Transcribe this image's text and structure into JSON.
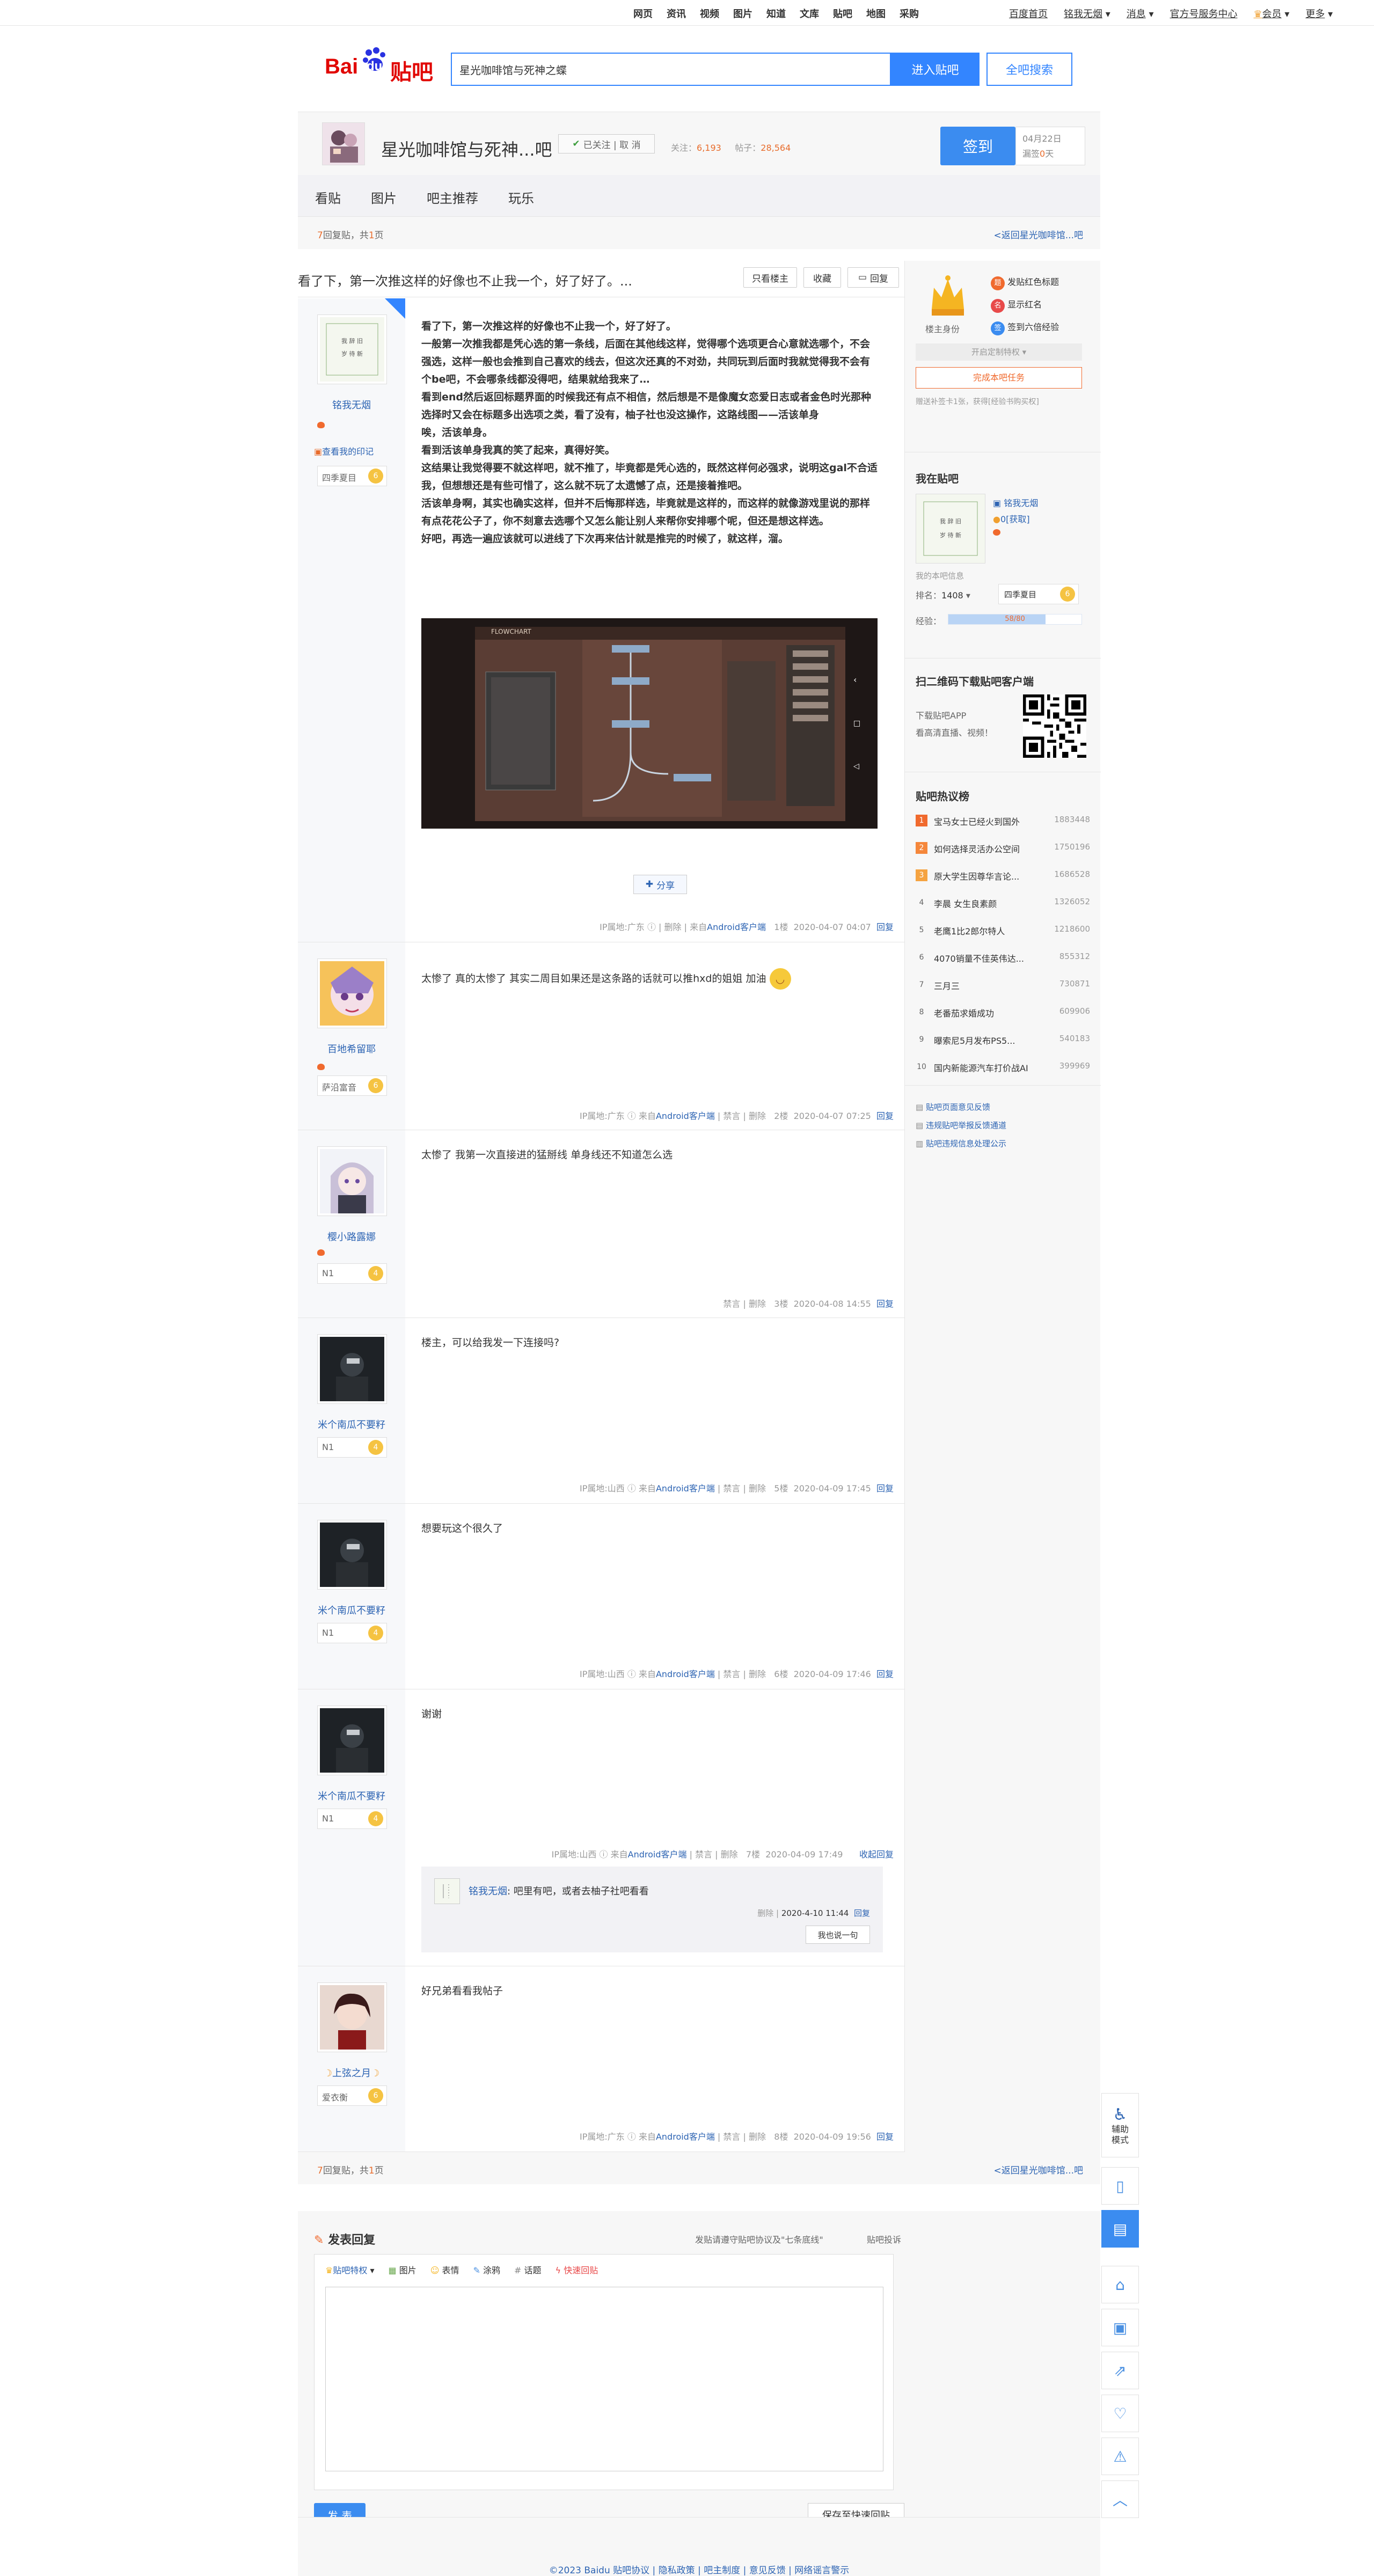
{
  "topnav": {
    "links": [
      "网页",
      "资讯",
      "视频",
      "图片",
      "知道",
      "文库",
      "贴吧",
      "地图",
      "采购"
    ],
    "right": [
      "百度首页",
      "铭我无烟",
      "消息",
      "官方号服务中心",
      "会员",
      "更多"
    ]
  },
  "header": {
    "logo_bai": "Bai",
    "logo_du": "du",
    "logo_tieba": "贴吧",
    "search_value": "星光咖啡馆与死神之蝶",
    "enter_label": "进入贴吧",
    "all_label": "全吧搜索"
  },
  "forum": {
    "name": "星光咖啡馆与死神...吧",
    "follow": "已关注 | 取 消",
    "follow_label": "关注：",
    "follow_count": "6,193",
    "posts_label": "帖子：",
    "posts_count": "28,564",
    "sign": "签到",
    "sign_date": "04月22日",
    "sign_days_label": "漏签",
    "sign_days": "0",
    "sign_days_unit": "天"
  },
  "tabs": [
    "看贴",
    "图片",
    "吧主推荐",
    "玩乐"
  ],
  "pager": {
    "replies": "7",
    "text": "回复贴，共",
    "pages": "1",
    "unit": "页",
    "back": "<返回星光咖啡馆...吧"
  },
  "thread": {
    "title": "看了下，第一次推这样的好像也不止我一个，好了好了。...",
    "only_op": "只看楼主",
    "collect": "收藏",
    "reply": "回复"
  },
  "posts": [
    {
      "author": "铭我无烟",
      "badge": "查看我的印记",
      "level_name": "四季夏目",
      "level": "6",
      "paragraphs": [
        "看了下，第一次推这样的好像也不止我一个，好了好了。",
        "一般第一次推我都是凭心选的第一条线，后面在其他线这样，觉得哪个选项更合心意就选哪个，不会强选，这样一般也会推到自己喜欢的线去，但这次还真的不对劲，共同玩到后面时我就觉得我不会有个be吧，不会哪条线都没得吧，结果就给我来了…",
        "看到end然后返回标题界面的时候我还有点不相信，然后想是不是像魔女恋爱日志或者金色时光那种选择时又会在标题多出选项之类，看了没有，柚子社也没这操作，这路线图——活该单身",
        "唉，活该单身。",
        "看到活该单身我真的笑了起来，真得好笑。",
        "这结果让我觉得要不就这样吧，就不推了，毕竟都是凭心选的，既然这样何必强求，说明这gal不合适我，但想想还是有些可惜了，这么就不玩了太遗憾了点，还是接着推吧。",
        "活该单身啊，其实也确实这样，但并不后悔那样选，毕竟就是这样的，而这样的就像游戏里说的那样有点花花公子了，你不刻意去选哪个又怎么能让别人来帮你安排哪个呢，但还是想这样选。",
        "好吧，再选一遍应该就可以进线了下次再来估计就是推完的时候了，就这样，溜。"
      ],
      "image_title": "FLOWCHART",
      "share": "分享",
      "meta_ip": "IP属地:广东",
      "meta_del": "删除",
      "meta_from": "来自",
      "meta_client": "Android客户端",
      "meta_floor": "1楼",
      "meta_time": "2020-04-07 04:07",
      "meta_reply": "回复"
    },
    {
      "author": "百地希留耶",
      "level_name": "萨沿富音",
      "level": "6",
      "text": "太惨了 真的太惨了 其实二周目如果还是这条路的话就可以推hxd的姐姐 加油",
      "meta_ip": "IP属地:广东",
      "meta_client": "Android客户端",
      "meta_ban": "禁言",
      "meta_del": "删除",
      "meta_floor": "2楼",
      "meta_time": "2020-04-07 07:25",
      "meta_reply": "回复"
    },
    {
      "author": "樱小路露娜",
      "level_name": "N1",
      "level": "4",
      "text": "太惨了 我第一次直接进的猛掰线 单身线还不知道怎么选",
      "meta_ban": "禁言",
      "meta_del": "删除",
      "meta_floor": "3楼",
      "meta_time": "2020-04-08 14:55",
      "meta_reply": "回复"
    },
    {
      "author": "米个南瓜不要籽",
      "level_name": "N1",
      "level": "4",
      "text": "楼主，可以给我发一下连接吗?",
      "meta_ip": "IP属地:山西",
      "meta_client": "Android客户端",
      "meta_ban": "禁言",
      "meta_del": "删除",
      "meta_floor": "5楼",
      "meta_time": "2020-04-09 17:45",
      "meta_reply": "回复"
    },
    {
      "author": "米个南瓜不要籽",
      "level_name": "N1",
      "level": "4",
      "text": "想要玩这个很久了",
      "meta_ip": "IP属地:山西",
      "meta_client": "Android客户端",
      "meta_ban": "禁言",
      "meta_del": "删除",
      "meta_floor": "6楼",
      "meta_time": "2020-04-09 17:46",
      "meta_reply": "回复"
    },
    {
      "author": "米个南瓜不要籽",
      "level_name": "N1",
      "level": "4",
      "text": "谢谢",
      "meta_ip": "IP属地:山西",
      "meta_client": "Android客户端",
      "meta_ban": "禁言",
      "meta_del": "删除",
      "meta_floor": "7楼",
      "meta_time": "2020-04-09 17:49",
      "meta_reply": "收起回复",
      "sub_author": "铭我无烟",
      "sub_text": ": 吧里有吧，或者去柚子社吧看看",
      "sub_del": "删除",
      "sub_time": "2020-4-10 11:44",
      "sub_reply": "回复",
      "sub_btn": "我也说一句"
    },
    {
      "author": "上弦之月",
      "level_name": "爱衣衡",
      "level": "6",
      "text": "好兄弟看看我帖子",
      "meta_ip": "IP属地:广东",
      "meta_client": "Android客户端",
      "meta_ban": "禁言",
      "meta_del": "删除",
      "meta_floor": "8楼",
      "meta_time": "2020-04-09 19:56",
      "meta_reply": "回复"
    }
  ],
  "sidebar": {
    "identity": "楼主身份",
    "perk1": "发贴红色标题",
    "perk2": "显示红名",
    "perk3": "签到六倍经验",
    "custom": "开启定制特权",
    "task": "完成本吧任务",
    "gift_text": "赠送补签卡1张，获得[经验书购买权]",
    "mine_title": "我在贴吧",
    "mine_name": "铭我无烟",
    "mine_tbean": "0",
    "mine_get": "[获取]",
    "mine_info": "我的本吧信息",
    "rank_label": "排名：",
    "rank": "1408",
    "level_name": "四季夏目",
    "level": "6",
    "exp_label": "经验：",
    "exp_value": "58/80",
    "exp_fill": 0.73,
    "qr_title": "扫二维码下载贴吧客户端",
    "qr_t1": "下载贴吧APP",
    "qr_t2": "看高清直播、视频！",
    "hot_title": "贴吧热议榜",
    "hot": [
      {
        "n": "1",
        "t": "宝马女士已经火到国外",
        "c": "1883448"
      },
      {
        "n": "2",
        "t": "如何选择灵活办公空间",
        "c": "1750196"
      },
      {
        "n": "3",
        "t": "原大学生因尊华言论...",
        "c": "1686528"
      },
      {
        "n": "4",
        "t": "李晨 女生良素颜",
        "c": "1326052"
      },
      {
        "n": "5",
        "t": "老鹰1比2郎尔特人",
        "c": "1218600"
      },
      {
        "n": "6",
        "t": "4070销量不佳英伟达...",
        "c": "855312"
      },
      {
        "n": "7",
        "t": "三月三",
        "c": "730871"
      },
      {
        "n": "8",
        "t": "老番茄求婚成功",
        "c": "609906"
      },
      {
        "n": "9",
        "t": "曝索尼5月发布PS5...",
        "c": "540183"
      },
      {
        "n": "10",
        "t": "国内新能源汽车打价战AI",
        "c": "399969"
      }
    ],
    "links": [
      "贴吧页面意见反馈",
      "违规贴吧举报反馈通道",
      "贴吧违规信息处理公示"
    ]
  },
  "tools": {
    "assist": "辅助模式"
  },
  "bottom_pager": {
    "replies": "7",
    "text": "回复贴，共",
    "pages": "1",
    "unit": "页",
    "back": "<返回星光咖啡馆...吧"
  },
  "reply": {
    "title": "发表回复",
    "rule": "发贴请遵守贴吧协议及\"七条底线\"",
    "complaint": "贴吧投诉",
    "tb1": "贴吧特权",
    "tb2": "图片",
    "tb3": "表情",
    "tb4": "涂鸦",
    "tb5": "话题",
    "tb6": "快速回贴",
    "submit": "发 表",
    "save": "保存至快速回贴"
  },
  "footer": {
    "text": "©2023 Baidu 贴吧协议 | 隐私政策 | 吧主制度 | 意见反馈 | 网络谣言警示"
  }
}
